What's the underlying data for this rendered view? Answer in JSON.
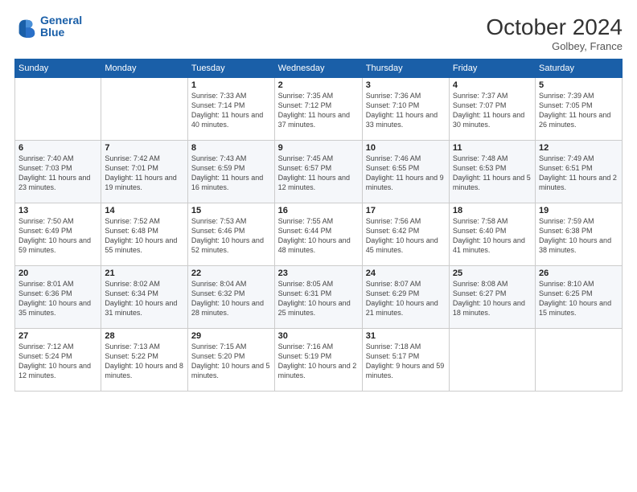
{
  "header": {
    "logo_line1": "General",
    "logo_line2": "Blue",
    "month": "October 2024",
    "location": "Golbey, France"
  },
  "days_of_week": [
    "Sunday",
    "Monday",
    "Tuesday",
    "Wednesday",
    "Thursday",
    "Friday",
    "Saturday"
  ],
  "weeks": [
    [
      {
        "day": "",
        "info": ""
      },
      {
        "day": "",
        "info": ""
      },
      {
        "day": "1",
        "info": "Sunrise: 7:33 AM\nSunset: 7:14 PM\nDaylight: 11 hours and 40 minutes."
      },
      {
        "day": "2",
        "info": "Sunrise: 7:35 AM\nSunset: 7:12 PM\nDaylight: 11 hours and 37 minutes."
      },
      {
        "day": "3",
        "info": "Sunrise: 7:36 AM\nSunset: 7:10 PM\nDaylight: 11 hours and 33 minutes."
      },
      {
        "day": "4",
        "info": "Sunrise: 7:37 AM\nSunset: 7:07 PM\nDaylight: 11 hours and 30 minutes."
      },
      {
        "day": "5",
        "info": "Sunrise: 7:39 AM\nSunset: 7:05 PM\nDaylight: 11 hours and 26 minutes."
      }
    ],
    [
      {
        "day": "6",
        "info": "Sunrise: 7:40 AM\nSunset: 7:03 PM\nDaylight: 11 hours and 23 minutes."
      },
      {
        "day": "7",
        "info": "Sunrise: 7:42 AM\nSunset: 7:01 PM\nDaylight: 11 hours and 19 minutes."
      },
      {
        "day": "8",
        "info": "Sunrise: 7:43 AM\nSunset: 6:59 PM\nDaylight: 11 hours and 16 minutes."
      },
      {
        "day": "9",
        "info": "Sunrise: 7:45 AM\nSunset: 6:57 PM\nDaylight: 11 hours and 12 minutes."
      },
      {
        "day": "10",
        "info": "Sunrise: 7:46 AM\nSunset: 6:55 PM\nDaylight: 11 hours and 9 minutes."
      },
      {
        "day": "11",
        "info": "Sunrise: 7:48 AM\nSunset: 6:53 PM\nDaylight: 11 hours and 5 minutes."
      },
      {
        "day": "12",
        "info": "Sunrise: 7:49 AM\nSunset: 6:51 PM\nDaylight: 11 hours and 2 minutes."
      }
    ],
    [
      {
        "day": "13",
        "info": "Sunrise: 7:50 AM\nSunset: 6:49 PM\nDaylight: 10 hours and 59 minutes."
      },
      {
        "day": "14",
        "info": "Sunrise: 7:52 AM\nSunset: 6:48 PM\nDaylight: 10 hours and 55 minutes."
      },
      {
        "day": "15",
        "info": "Sunrise: 7:53 AM\nSunset: 6:46 PM\nDaylight: 10 hours and 52 minutes."
      },
      {
        "day": "16",
        "info": "Sunrise: 7:55 AM\nSunset: 6:44 PM\nDaylight: 10 hours and 48 minutes."
      },
      {
        "day": "17",
        "info": "Sunrise: 7:56 AM\nSunset: 6:42 PM\nDaylight: 10 hours and 45 minutes."
      },
      {
        "day": "18",
        "info": "Sunrise: 7:58 AM\nSunset: 6:40 PM\nDaylight: 10 hours and 41 minutes."
      },
      {
        "day": "19",
        "info": "Sunrise: 7:59 AM\nSunset: 6:38 PM\nDaylight: 10 hours and 38 minutes."
      }
    ],
    [
      {
        "day": "20",
        "info": "Sunrise: 8:01 AM\nSunset: 6:36 PM\nDaylight: 10 hours and 35 minutes."
      },
      {
        "day": "21",
        "info": "Sunrise: 8:02 AM\nSunset: 6:34 PM\nDaylight: 10 hours and 31 minutes."
      },
      {
        "day": "22",
        "info": "Sunrise: 8:04 AM\nSunset: 6:32 PM\nDaylight: 10 hours and 28 minutes."
      },
      {
        "day": "23",
        "info": "Sunrise: 8:05 AM\nSunset: 6:31 PM\nDaylight: 10 hours and 25 minutes."
      },
      {
        "day": "24",
        "info": "Sunrise: 8:07 AM\nSunset: 6:29 PM\nDaylight: 10 hours and 21 minutes."
      },
      {
        "day": "25",
        "info": "Sunrise: 8:08 AM\nSunset: 6:27 PM\nDaylight: 10 hours and 18 minutes."
      },
      {
        "day": "26",
        "info": "Sunrise: 8:10 AM\nSunset: 6:25 PM\nDaylight: 10 hours and 15 minutes."
      }
    ],
    [
      {
        "day": "27",
        "info": "Sunrise: 7:12 AM\nSunset: 5:24 PM\nDaylight: 10 hours and 12 minutes."
      },
      {
        "day": "28",
        "info": "Sunrise: 7:13 AM\nSunset: 5:22 PM\nDaylight: 10 hours and 8 minutes."
      },
      {
        "day": "29",
        "info": "Sunrise: 7:15 AM\nSunset: 5:20 PM\nDaylight: 10 hours and 5 minutes."
      },
      {
        "day": "30",
        "info": "Sunrise: 7:16 AM\nSunset: 5:19 PM\nDaylight: 10 hours and 2 minutes."
      },
      {
        "day": "31",
        "info": "Sunrise: 7:18 AM\nSunset: 5:17 PM\nDaylight: 9 hours and 59 minutes."
      },
      {
        "day": "",
        "info": ""
      },
      {
        "day": "",
        "info": ""
      }
    ]
  ]
}
